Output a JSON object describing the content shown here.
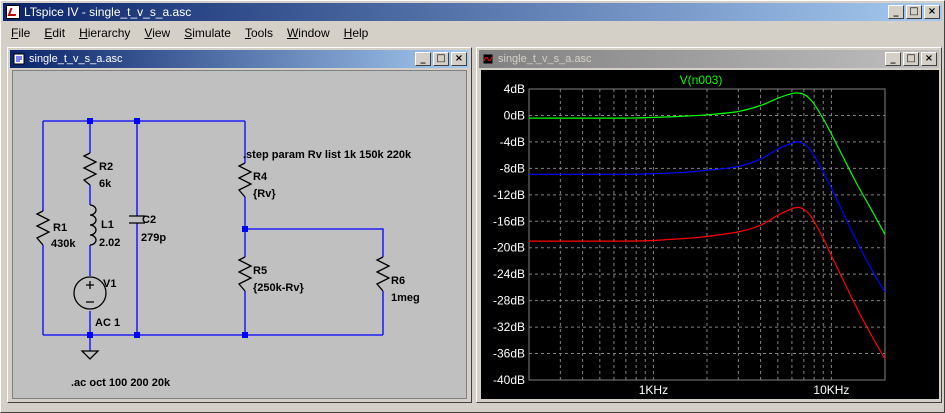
{
  "app": {
    "title": "LTspice IV - single_t_v_s_a.asc",
    "window_buttons": [
      "_",
      "□",
      "×"
    ]
  },
  "menu": {
    "items": [
      {
        "label": "File",
        "accel": "F",
        "rest": "ile"
      },
      {
        "label": "Edit",
        "accel": "E",
        "rest": "dit"
      },
      {
        "label": "Hierarchy",
        "accel": "H",
        "rest": "ierarchy"
      },
      {
        "label": "View",
        "accel": "V",
        "rest": "iew"
      },
      {
        "label": "Simulate",
        "accel": "S",
        "rest": "imulate"
      },
      {
        "label": "Tools",
        "accel": "T",
        "rest": "ools"
      },
      {
        "label": "Window",
        "accel": "W",
        "rest": "indow"
      },
      {
        "label": "Help",
        "accel": "H",
        "rest": "elp"
      }
    ]
  },
  "schematic": {
    "window_title": "single_t_v_s_a.asc",
    "directive_step": ".step param Rv list 1k 150k 220k",
    "directive_ac": ".ac oct 100 200 20k",
    "components": {
      "r1": {
        "name": "R1",
        "value": "430k"
      },
      "r2": {
        "name": "R2",
        "value": "6k"
      },
      "l1": {
        "name": "L1",
        "value": "2.02"
      },
      "c2": {
        "name": "C2",
        "value": "279p"
      },
      "v1": {
        "name": "V1",
        "value": "AC 1"
      },
      "r4": {
        "name": "R4",
        "value": "{Rv}"
      },
      "r5": {
        "name": "R5",
        "value": "{250k-Rv}"
      },
      "r6": {
        "name": "R6",
        "value": "1meg"
      }
    },
    "colors": {
      "wire": "#0000ff",
      "component": "#000000",
      "node": "#0000ff",
      "background": "#c0c0c0"
    }
  },
  "waveform": {
    "window_title": "single_t_v_s_a.asc",
    "trace_label": "V(n003)",
    "colors": {
      "background": "#000000",
      "grid": "#808080",
      "axis_text": "#ffffff",
      "label": "#00ff00"
    }
  },
  "chart_data": {
    "type": "line",
    "title": "V(n003)",
    "x_scale": "log",
    "xlim": [
      200,
      20000
    ],
    "ylim": [
      -40,
      4
    ],
    "y_ticks": [
      4,
      0,
      -4,
      -8,
      -12,
      -16,
      -20,
      -24,
      -28,
      -32,
      -36,
      -40
    ],
    "y_tick_labels": [
      "4dB",
      "0dB",
      "-4dB",
      "-8dB",
      "-12dB",
      "-16dB",
      "-20dB",
      "-24dB",
      "-28dB",
      "-32dB",
      "-36dB",
      "-40dB"
    ],
    "x_ticks": [
      1000,
      10000
    ],
    "x_tick_labels": [
      "1KHz",
      "10KHz"
    ],
    "grid": true,
    "series": [
      {
        "color": "#00ff00",
        "x": [
          200,
          400,
          700,
          1000,
          1500,
          2000,
          3000,
          4000,
          5000,
          6000,
          6500,
          7000,
          7500,
          8000,
          9000,
          10000,
          12000,
          14000,
          17000,
          20000
        ],
        "y": [
          -0.4,
          -0.4,
          -0.4,
          -0.3,
          -0.1,
          0.1,
          0.6,
          1.5,
          2.6,
          3.3,
          3.4,
          3.2,
          2.6,
          1.7,
          -0.5,
          -2.8,
          -7.0,
          -10.5,
          -14.5,
          -18.0
        ]
      },
      {
        "color": "#0000ff",
        "x": [
          200,
          400,
          700,
          1000,
          1500,
          2000,
          3000,
          4000,
          5000,
          6000,
          6500,
          7000,
          7500,
          8000,
          9000,
          10000,
          12000,
          14000,
          17000,
          20000
        ],
        "y": [
          -8.9,
          -8.9,
          -8.9,
          -8.8,
          -8.6,
          -8.3,
          -7.7,
          -6.6,
          -5.1,
          -4.2,
          -4.0,
          -4.3,
          -5.0,
          -6.1,
          -8.6,
          -11.0,
          -15.5,
          -19.2,
          -23.5,
          -26.7
        ]
      },
      {
        "color": "#ff0000",
        "x": [
          200,
          400,
          700,
          1000,
          1500,
          2000,
          3000,
          4000,
          5000,
          6000,
          6500,
          7000,
          7500,
          8000,
          9000,
          10000,
          12000,
          14000,
          17000,
          20000
        ],
        "y": [
          -19.0,
          -19.0,
          -19.0,
          -18.9,
          -18.6,
          -18.3,
          -17.6,
          -16.6,
          -15.1,
          -14.1,
          -13.9,
          -14.2,
          -14.9,
          -16.0,
          -18.6,
          -21.2,
          -25.6,
          -29.3,
          -33.5,
          -36.8
        ]
      }
    ]
  }
}
